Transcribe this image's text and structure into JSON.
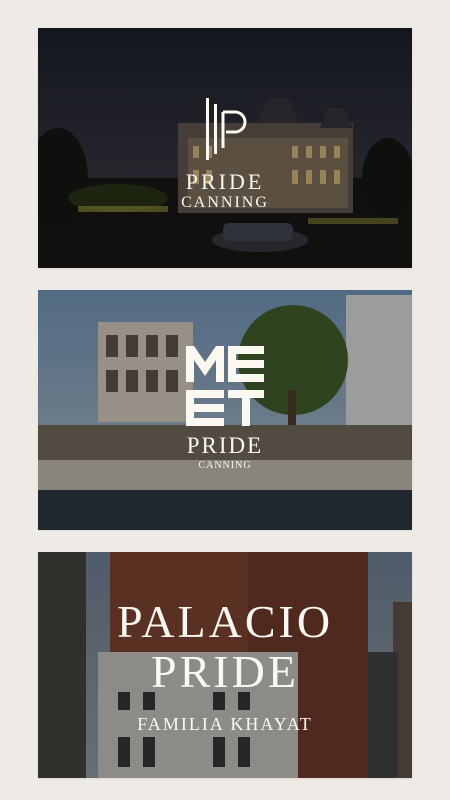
{
  "cards": [
    {
      "logo_lines": [
        "PRIDE",
        "CANNING"
      ],
      "logo_icon": "ip-monogram-icon"
    },
    {
      "logo_word": "MEET",
      "logo_lines": [
        "PRIDE",
        "CANNING"
      ]
    },
    {
      "title_lines": [
        "PALACIO",
        "PRIDE"
      ],
      "subtitle": "FAMILIA KHAYAT"
    }
  ]
}
